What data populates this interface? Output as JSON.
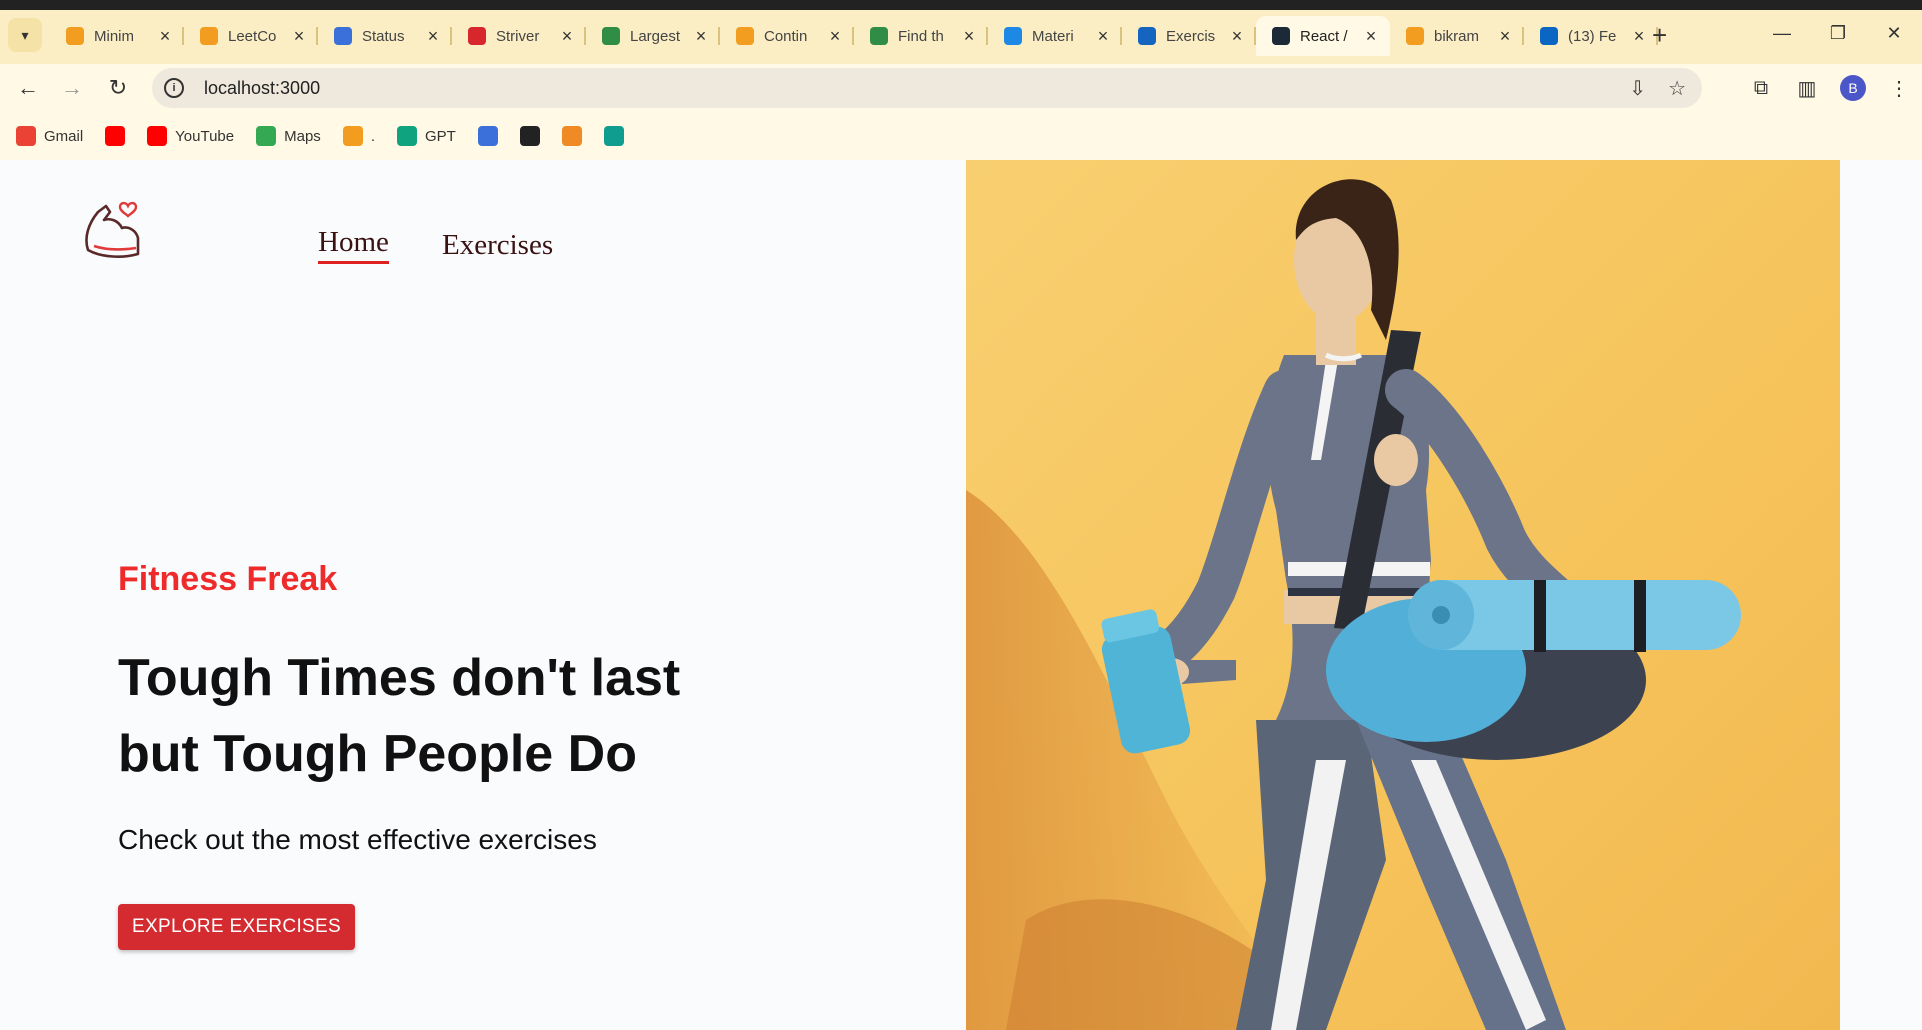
{
  "tabs": [
    {
      "title": "Minim",
      "icon": "leetcode-icon",
      "color": "#f29d1f"
    },
    {
      "title": "LeetCo",
      "icon": "leetcode-icon",
      "color": "#f29d1f"
    },
    {
      "title": "Status",
      "icon": "bar-chart-icon",
      "color": "#3b6fd9"
    },
    {
      "title": "Striver",
      "icon": "tuf-icon",
      "color": "#d8262d"
    },
    {
      "title": "Largest",
      "icon": "geeksforgeeks-icon",
      "color": "#2f8d46"
    },
    {
      "title": "Contin",
      "icon": "leetcode-icon",
      "color": "#f29d1f"
    },
    {
      "title": "Find th",
      "icon": "geeksforgeeks-icon",
      "color": "#2f8d46"
    },
    {
      "title": "Materi",
      "icon": "mui-icon",
      "color": "#1e88e5"
    },
    {
      "title": "Exercis",
      "icon": "search-q-icon",
      "color": "#1565c0"
    },
    {
      "title": "React /",
      "icon": "react-icon",
      "color": "#1b2a36",
      "active": true
    },
    {
      "title": "bikram",
      "icon": "leetcode-icon",
      "color": "#f29d1f"
    },
    {
      "title": "(13) Fe",
      "icon": "linkedin-icon",
      "color": "#0a66c2"
    }
  ],
  "toolbar": {
    "url": "localhost:3000",
    "avatar_letter": "B"
  },
  "bookmarks": [
    {
      "label": "Gmail",
      "icon": "gmail-icon",
      "color": "#ea4335"
    },
    {
      "label": "",
      "icon": "youtube-icon",
      "color": "#ff0000"
    },
    {
      "label": "YouTube",
      "icon": "youtube-icon",
      "color": "#ff0000"
    },
    {
      "label": "Maps",
      "icon": "maps-icon",
      "color": "#34a853"
    },
    {
      "label": ".",
      "icon": "leetcode-icon",
      "color": "#f29d1f"
    },
    {
      "label": "GPT",
      "icon": "chatgpt-icon",
      "color": "#10a37f"
    },
    {
      "label": "",
      "icon": "bar-chart-icon",
      "color": "#3b6fd9"
    },
    {
      "label": "",
      "icon": "github-icon",
      "color": "#222222"
    },
    {
      "label": "",
      "icon": "codeforces-icon",
      "color": "#f08a24"
    },
    {
      "label": "",
      "icon": "diamond-icon",
      "color": "#0f9d8f"
    }
  ],
  "nav": {
    "home": "Home",
    "exercises": "Exercises"
  },
  "hero": {
    "brand": "Fitness Freak",
    "headline_line1": "Tough Times don't last",
    "headline_line2": "but Tough People Do",
    "subtitle": "Check out the most effective exercises",
    "cta": "EXPLORE EXERCISES"
  },
  "colors": {
    "accent": "#ef2a2a",
    "button": "#d32b2f",
    "hero_bg": "#f6c35a"
  }
}
